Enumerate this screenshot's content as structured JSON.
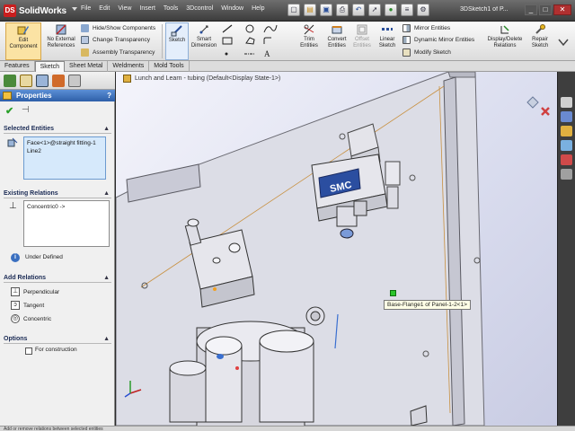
{
  "app": {
    "logo": "SolidWorks",
    "menu": [
      "File",
      "Edit",
      "View",
      "Insert",
      "Tools",
      "3Dcontrol",
      "Window",
      "Help"
    ],
    "document_title": "3DSketch1 of P...",
    "window_controls": {
      "minimize": "_",
      "maximize": "□",
      "close": "✕"
    }
  },
  "toolbar": {
    "edit_component": "Edit Component",
    "no_external": "No External References",
    "hide_show": "Hide/Show Components",
    "change_transparency": "Change Transparency",
    "assembly_transparency": "Assembly Transparency",
    "sketch": "Sketch",
    "smart_dimension": "Smart Dimension",
    "trim": "Trim Entities",
    "convert": "Convert Entities",
    "offset": "Offset Entities",
    "linear": "Linear Sketch",
    "mirror": "Mirror Entities",
    "dynamic_mirror": "Dynamic Mirror Entities",
    "modify": "Modify Sketch",
    "display_delete": "Display/Delete Relations",
    "repair": "Repair Sketch"
  },
  "tabs": [
    "Features",
    "Sketch",
    "Sheet Metal",
    "Weldments",
    "Mold Tools"
  ],
  "active_tab": "Sketch",
  "panel": {
    "title": "Properties",
    "help": "?",
    "selected_heading": "Selected Entities",
    "selected_items": [
      "Face<1>@straight fitting-1",
      "Line2"
    ],
    "existing_heading": "Existing Relations",
    "existing_items": [
      "Concentric0 ->"
    ],
    "status": "Under Defined",
    "add_heading": "Add Relations",
    "relations": [
      "Perpendicular",
      "Tangent",
      "Concentric"
    ],
    "options_heading": "Options",
    "construction_label": "For construction",
    "construction_checked": false
  },
  "viewport": {
    "breadcrumb": "Lunch and Learn - tubing (Default<Display State-1>)",
    "tooltip": "Base-Flange1 of Panel-1-2<1>",
    "brand_label": "SMC"
  },
  "statusbar": "Add or remove relations between selected entities"
}
